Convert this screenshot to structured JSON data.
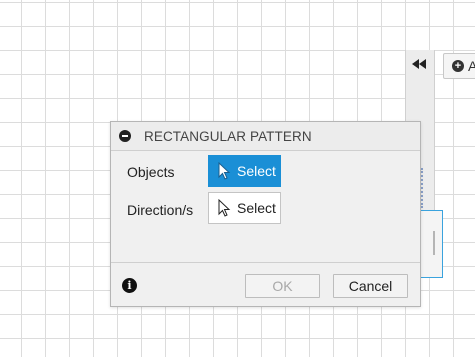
{
  "panel": {
    "right_tool_label": "A"
  },
  "dialog": {
    "title": "RECTANGULAR PATTERN",
    "rows": [
      {
        "label": "Objects",
        "button": "Select",
        "active": true
      },
      {
        "label": "Direction/s",
        "button": "Select",
        "active": false
      }
    ],
    "ok_label": "OK",
    "cancel_label": "Cancel"
  },
  "colors": {
    "accent": "#1a8fd6",
    "frame_blue": "#3aa3de"
  },
  "icons": [
    "collapse-double-arrow-icon",
    "plus-circle-icon",
    "minus-circle-icon",
    "cursor-arrow-icon",
    "info-icon"
  ]
}
